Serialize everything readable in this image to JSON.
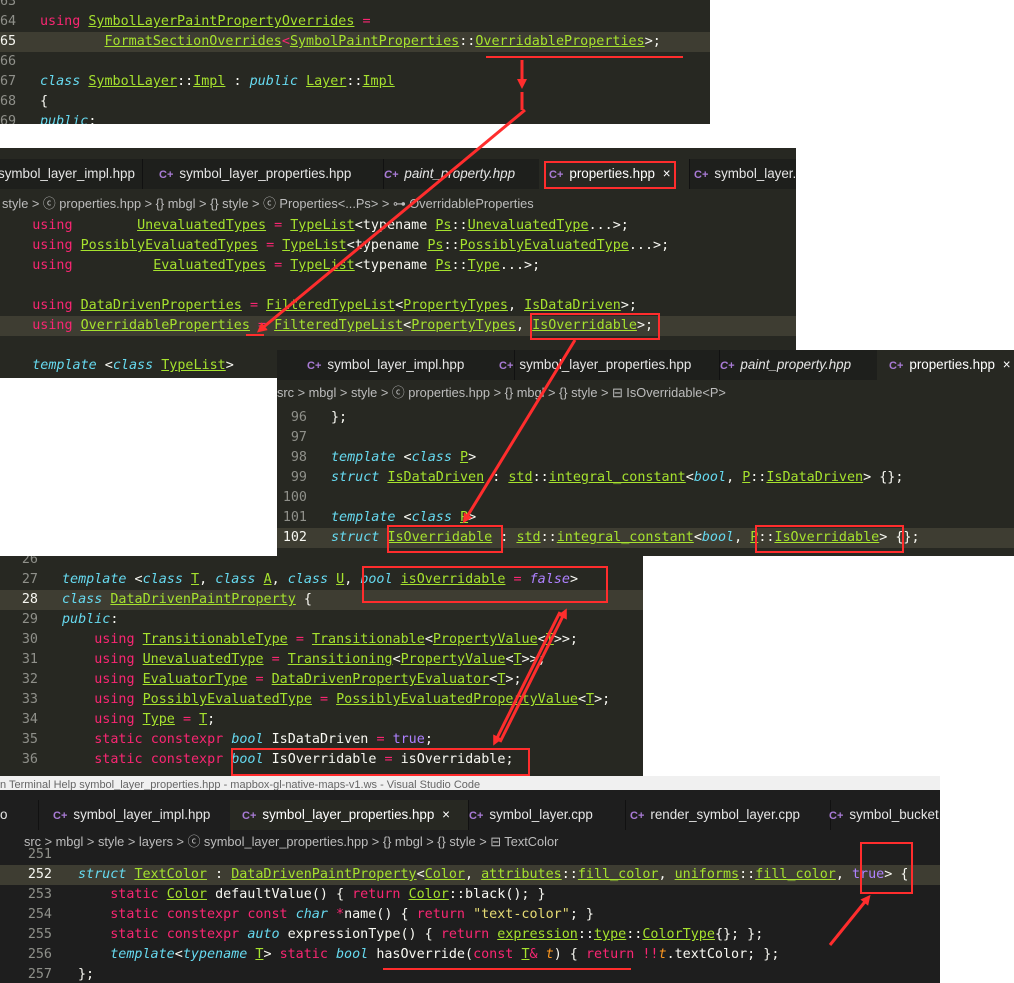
{
  "panel1": {
    "lines": [
      {
        "n": "63",
        "html": ""
      },
      {
        "n": "64",
        "html": "<span class=\"k\">using</span> <span class=\"t\">SymbolLayerPaintPropertyOverrides</span> <span class=\"o\">=</span>"
      },
      {
        "n": "65",
        "html": "        <span class=\"t\">FormatSectionOverrides</span><span class=\"o\">&lt;</span><span class=\"t\">SymbolPaintProperties</span>::<span class=\"t\">OverridableProperties</span>&gt;;"
      },
      {
        "n": "66",
        "html": ""
      },
      {
        "n": "67",
        "html": "<span class=\"s\">class</span> <span class=\"t\">SymbolLayer</span>::<span class=\"t\">Impl</span> : <span class=\"s\">public</span> <span class=\"t\">Layer</span>::<span class=\"t\">Impl</span>"
      },
      {
        "n": "68",
        "html": "{"
      },
      {
        "n": "69",
        "html": "<span class=\"s\">public</span>:"
      }
    ]
  },
  "panel2": {
    "tabs": [
      "symbol_layer_impl.hpp",
      "symbol_layer_properties.hpp",
      "paint_property.hpp",
      "properties.hpp",
      "symbol_layer.c"
    ],
    "close": "×",
    "crumbs": "style  > ⓒ properties.hpp > {} mbgl > {} style > ⓒ Properties<...Ps> > ⊶ OverridableProperties",
    "lines": [
      {
        "html": "    <span class=\"k\">using</span>        <span class=\"t\">UnevaluatedTypes</span> <span class=\"o\">=</span> <span class=\"t\">TypeList</span>&lt;typename <span class=\"t\">Ps</span>::<span class=\"t\">UnevaluatedType</span>...&gt;;"
      },
      {
        "html": "    <span class=\"k\">using</span> <span class=\"t\">PossiblyEvaluatedTypes</span> <span class=\"o\">=</span> <span class=\"t\">TypeList</span>&lt;typename <span class=\"t\">Ps</span>::<span class=\"t\">PossiblyEvaluatedType</span>...&gt;;"
      },
      {
        "html": "    <span class=\"k\">using</span>          <span class=\"t\">EvaluatedTypes</span> <span class=\"o\">=</span> <span class=\"t\">TypeList</span>&lt;typename <span class=\"t\">Ps</span>::<span class=\"t\">Type</span>...&gt;;"
      },
      {
        "html": ""
      },
      {
        "html": "    <span class=\"k\">using</span> <span class=\"t\">DataDrivenProperties</span> <span class=\"o\">=</span> <span class=\"t\">FilteredTypeList</span>&lt;<span class=\"t\">PropertyTypes</span>, <span class=\"t\">IsDataDriven</span>&gt;;"
      },
      {
        "html": "    <span class=\"k\">using</span> <span class=\"t\">OverridableProperties</span> <span class=\"o\">=</span> <span class=\"t\">FilteredTypeList</span>&lt;<span class=\"t\">PropertyTypes</span>, <span class=\"t\">IsOverridable</span>&gt;;"
      },
      {
        "html": ""
      },
      {
        "html": "    <span class=\"s\">template</span> &lt;<span class=\"s\">class</span> <span class=\"t\">TypeList</span>&gt;"
      }
    ]
  },
  "panel3": {
    "tabs": [
      "symbol_layer_impl.hpp",
      "symbol_layer_properties.hpp",
      "paint_property.hpp",
      "properties.hpp"
    ],
    "close": "×",
    "crumbs": "src > mbgl > style > ⓒ properties.hpp > {} mbgl > {} style > ⊟ IsOverridable<P>",
    "lines": [
      {
        "n": "96",
        "html": "};"
      },
      {
        "n": "97",
        "html": ""
      },
      {
        "n": "98",
        "html": "<span class=\"s\">template</span> &lt;<span class=\"s\">class</span> <span class=\"t\">P</span>&gt;"
      },
      {
        "n": "99",
        "html": "<span class=\"s\">struct</span> <span class=\"t\">IsDataDriven</span> : <span class=\"t\">std</span>::<span class=\"t\">integral_constant</span>&lt;<span class=\"s\">bool</span>, <span class=\"t\">P</span>::<span class=\"t\">IsDataDriven</span>&gt; {};"
      },
      {
        "n": "100",
        "html": ""
      },
      {
        "n": "101",
        "html": "<span class=\"s\">template</span> &lt;<span class=\"s\">class</span> <span class=\"t\">P</span>&gt;"
      },
      {
        "n": "102",
        "html": "<span class=\"s\">struct</span> <span class=\"t\">IsOverridable</span> : <span class=\"t\">std</span>::<span class=\"t\">integral_constant</span>&lt;<span class=\"s\">bool</span>, <span class=\"t\">P</span>::<span class=\"t\">IsOverridable</span>&gt; {};"
      }
    ]
  },
  "panel4": {
    "lines": [
      {
        "n": "26",
        "html": ""
      },
      {
        "n": "27",
        "html": "<span class=\"s\">template</span> &lt;<span class=\"s\">class</span> <span class=\"t\">T</span>, <span class=\"s\">class</span> <span class=\"t\">A</span>, <span class=\"s\">class</span> <span class=\"t\">U</span>, <span class=\"s\">bool</span> <span class=\"t\">isOverridable</span> <span class=\"o\">=</span> <span class=\"n\" style=\"font-style:italic\">false</span>&gt;"
      },
      {
        "n": "28",
        "html": "<span class=\"s\">class</span> <span class=\"t\">DataDrivenPaintProperty</span> {"
      },
      {
        "n": "29",
        "html": "<span class=\"s\">public</span>:"
      },
      {
        "n": "30",
        "html": "    <span class=\"k\">using</span> <span class=\"t\">TransitionableType</span> <span class=\"o\">=</span> <span class=\"t\">Transitionable</span>&lt;<span class=\"t\">PropertyValue</span>&lt;<span class=\"t\">T</span>&gt;&gt;;"
      },
      {
        "n": "31",
        "html": "    <span class=\"k\">using</span> <span class=\"t\">UnevaluatedType</span> <span class=\"o\">=</span> <span class=\"t\">Transitioning</span>&lt;<span class=\"t\">PropertyValue</span>&lt;<span class=\"t\">T</span>&gt;&gt;;"
      },
      {
        "n": "32",
        "html": "    <span class=\"k\">using</span> <span class=\"t\">EvaluatorType</span> <span class=\"o\">=</span> <span class=\"t\">DataDrivenPropertyEvaluator</span>&lt;<span class=\"t\">T</span>&gt;;"
      },
      {
        "n": "33",
        "html": "    <span class=\"k\">using</span> <span class=\"t\">PossiblyEvaluatedType</span> <span class=\"o\">=</span> <span class=\"t\">PossiblyEvaluatedPropertyValue</span>&lt;<span class=\"t\">T</span>&gt;;"
      },
      {
        "n": "34",
        "html": "    <span class=\"k\">using</span> <span class=\"t\">Type</span> <span class=\"o\">=</span> <span class=\"t\">T</span>;"
      },
      {
        "n": "35",
        "html": "    <span class=\"k\">static</span> <span class=\"k\">constexpr</span> <span class=\"s\">bool</span> <span class=\"w\">IsDataDriven</span> <span class=\"o\">=</span> <span class=\"n\">true</span>;"
      },
      {
        "n": "36",
        "html": "    <span class=\"k\">static</span> <span class=\"k\">constexpr</span> <span class=\"s\">bool</span> <span class=\"w\">IsOverridable</span> <span class=\"o\">=</span> <span class=\"w\">isOverridable</span>;"
      }
    ]
  },
  "strip": "n   Terminal   Help                symbol_layer_properties.hpp - mapbox-gl-native-maps-v1.ws - Visual Studio Code",
  "panel5": {
    "tabs": [
      "symbol_layer_impl.hpp",
      "symbol_layer_properties.hpp",
      "symbol_layer.cpp",
      "render_symbol_layer.cpp",
      "symbol_bucket.c"
    ],
    "close": "×",
    "crumbs": "src > mbgl > style > layers > ⓒ symbol_layer_properties.hpp > {} mbgl > {} style > ⊟ TextColor",
    "lines": [
      {
        "n": "251",
        "html": ""
      },
      {
        "n": "252",
        "html": "<span class=\"s\">struct</span> <span class=\"t\">TextColor</span> : <span class=\"t\">DataDrivenPaintProperty</span>&lt;<span class=\"t\">Color</span>, <span class=\"t\">attributes</span>::<span class=\"t\">fill_color</span>, <span class=\"t\">uniforms</span>::<span class=\"t\">fill_color</span>, <span class=\"n\">true</span>&gt; {"
      },
      {
        "n": "253",
        "html": "    <span class=\"k\">static</span> <span class=\"t\">Color</span> <span class=\"w\">defaultValue</span>() { <span class=\"k\">return</span> <span class=\"t\">Color</span>::<span class=\"w\">black</span>(); }"
      },
      {
        "n": "254",
        "html": "    <span class=\"k\">static</span> <span class=\"k\">constexpr</span> <span class=\"k\">const</span> <span class=\"s\">char</span> <span class=\"o\">*</span>name() { <span class=\"k\">return</span> <span class=\"str\">\"text-color\"</span>; }"
      },
      {
        "n": "255",
        "html": "    <span class=\"k\">static</span> <span class=\"k\">constexpr</span> <span class=\"s\">auto</span> <span class=\"w\">expressionType</span>() { <span class=\"k\">return</span> <span class=\"t\">expression</span>::<span class=\"t\">type</span>::<span class=\"t\">ColorType</span>{}; };"
      },
      {
        "n": "256",
        "html": "    <span class=\"s\">template</span>&lt;<span class=\"s\">typename</span> <span class=\"t\">T</span>&gt; <span class=\"k\">static</span> <span class=\"s\">bool</span> <span class=\"w\">hasOverride</span>(<span class=\"k\">const</span> <span class=\"t\">T</span><span class=\"o\">&amp;</span> <span class=\"p\">t</span>) { <span class=\"k\">return</span> <span class=\"o\">!!</span><span class=\"p\">t</span>.textColor; };"
      },
      {
        "n": "257",
        "html": "};"
      }
    ]
  }
}
